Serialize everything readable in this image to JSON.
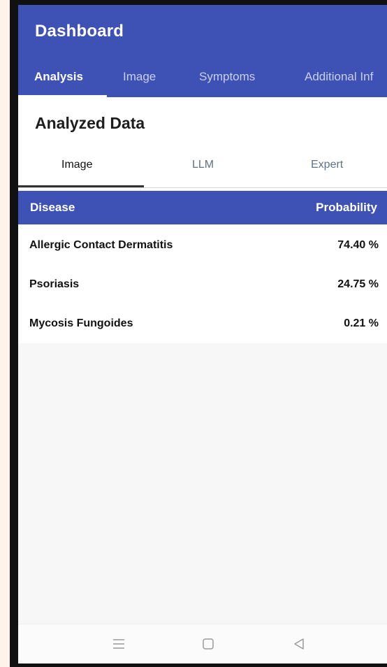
{
  "app": {
    "title": "Dashboard"
  },
  "top_tabs": [
    {
      "label": "Analysis",
      "active": true
    },
    {
      "label": "Image",
      "active": false
    },
    {
      "label": "Symptoms",
      "active": false
    },
    {
      "label": "Additional Inf",
      "active": false
    }
  ],
  "section": {
    "title": "Analyzed Data"
  },
  "sub_tabs": [
    {
      "label": "Image",
      "active": true
    },
    {
      "label": "LLM",
      "active": false
    },
    {
      "label": "Expert",
      "active": false
    }
  ],
  "table": {
    "headers": {
      "disease": "Disease",
      "probability": "Probability"
    },
    "rows": [
      {
        "disease": "Allergic Contact Dermatitis",
        "probability": "74.40 %"
      },
      {
        "disease": "Psoriasis",
        "probability": "24.75 %"
      },
      {
        "disease": "Mycosis Fungoides",
        "probability": "0.21 %"
      }
    ]
  },
  "nav": {
    "icons": [
      "menu-icon",
      "home-icon",
      "back-icon"
    ]
  },
  "colors": {
    "primary": "#3e51b5",
    "background": "#f7f7f7",
    "text": "#111111"
  }
}
